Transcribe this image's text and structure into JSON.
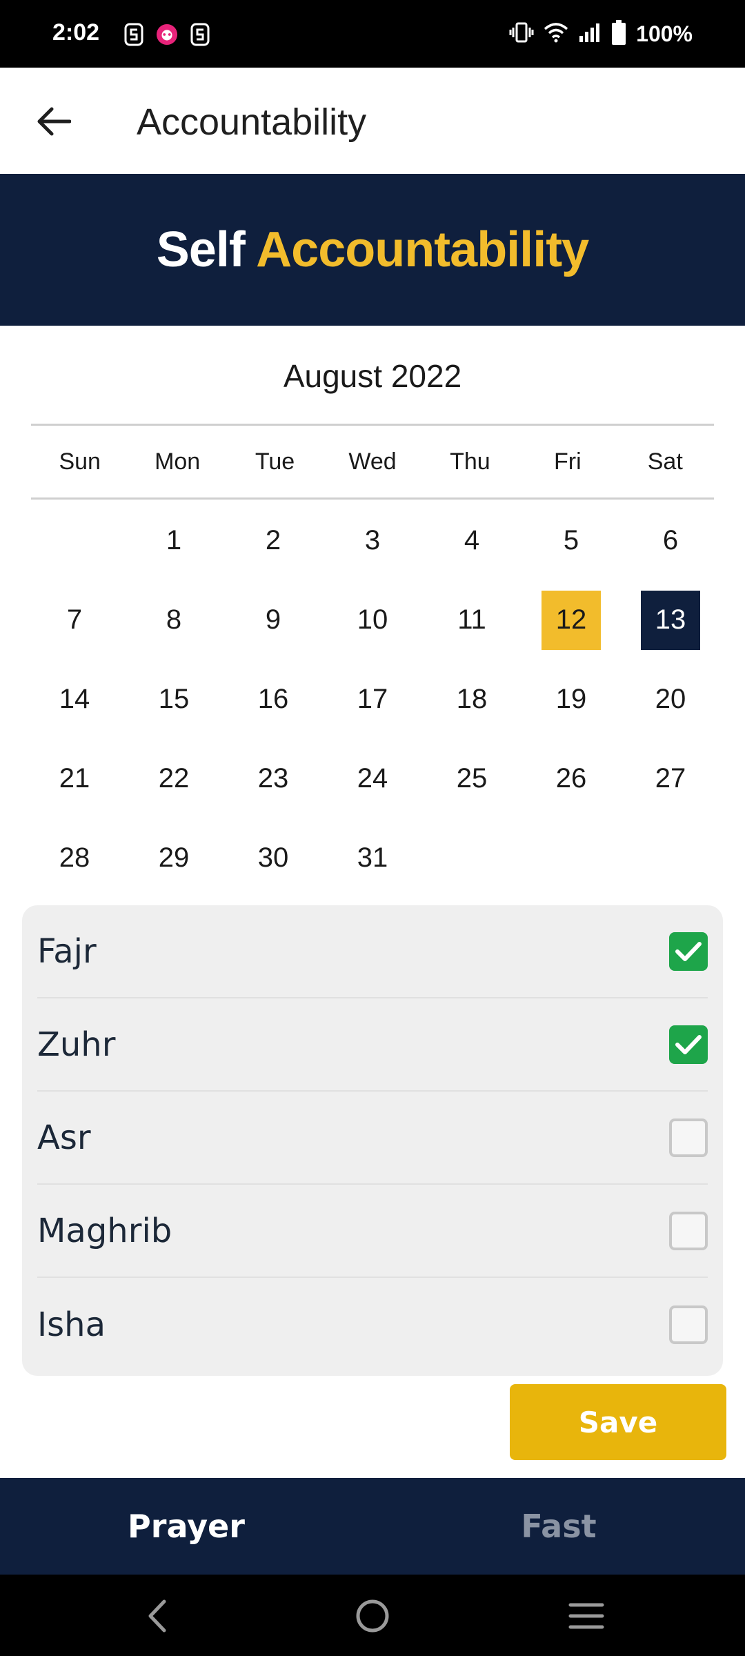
{
  "status_bar": {
    "time": "2:02",
    "battery": "100%",
    "left_icons": [
      "s-notification-icon",
      "pink-app-icon",
      "s-notification-icon"
    ],
    "right_icons": [
      "vibrate-icon",
      "wifi-icon",
      "signal-icon",
      "battery-icon"
    ]
  },
  "app_bar": {
    "title": "Accountability",
    "back_icon": "arrow-left-icon"
  },
  "banner": {
    "word1": "Self",
    "word2": "Accountability",
    "colors": {
      "background": "#0f1f3d",
      "accent": "#f2bc2c"
    }
  },
  "calendar": {
    "month_title": "August 2022",
    "weekdays": [
      "Sun",
      "Mon",
      "Tue",
      "Wed",
      "Thu",
      "Fri",
      "Sat"
    ],
    "first_weekday_offset": 1,
    "days_in_month": 31,
    "today": 12,
    "selected": 13
  },
  "prayers": [
    {
      "name": "Fajr",
      "checked": true
    },
    {
      "name": "Zuhr",
      "checked": true
    },
    {
      "name": "Asr",
      "checked": false
    },
    {
      "name": "Maghrib",
      "checked": false
    },
    {
      "name": "Isha",
      "checked": false
    }
  ],
  "save_label": "Save",
  "tabs": [
    {
      "label": "Prayer",
      "active": true
    },
    {
      "label": "Fast",
      "active": false
    }
  ],
  "colors": {
    "navy": "#0f1f3d",
    "gold": "#f2bc2c",
    "save": "#e8b50c",
    "check_green": "#1ea54a"
  }
}
